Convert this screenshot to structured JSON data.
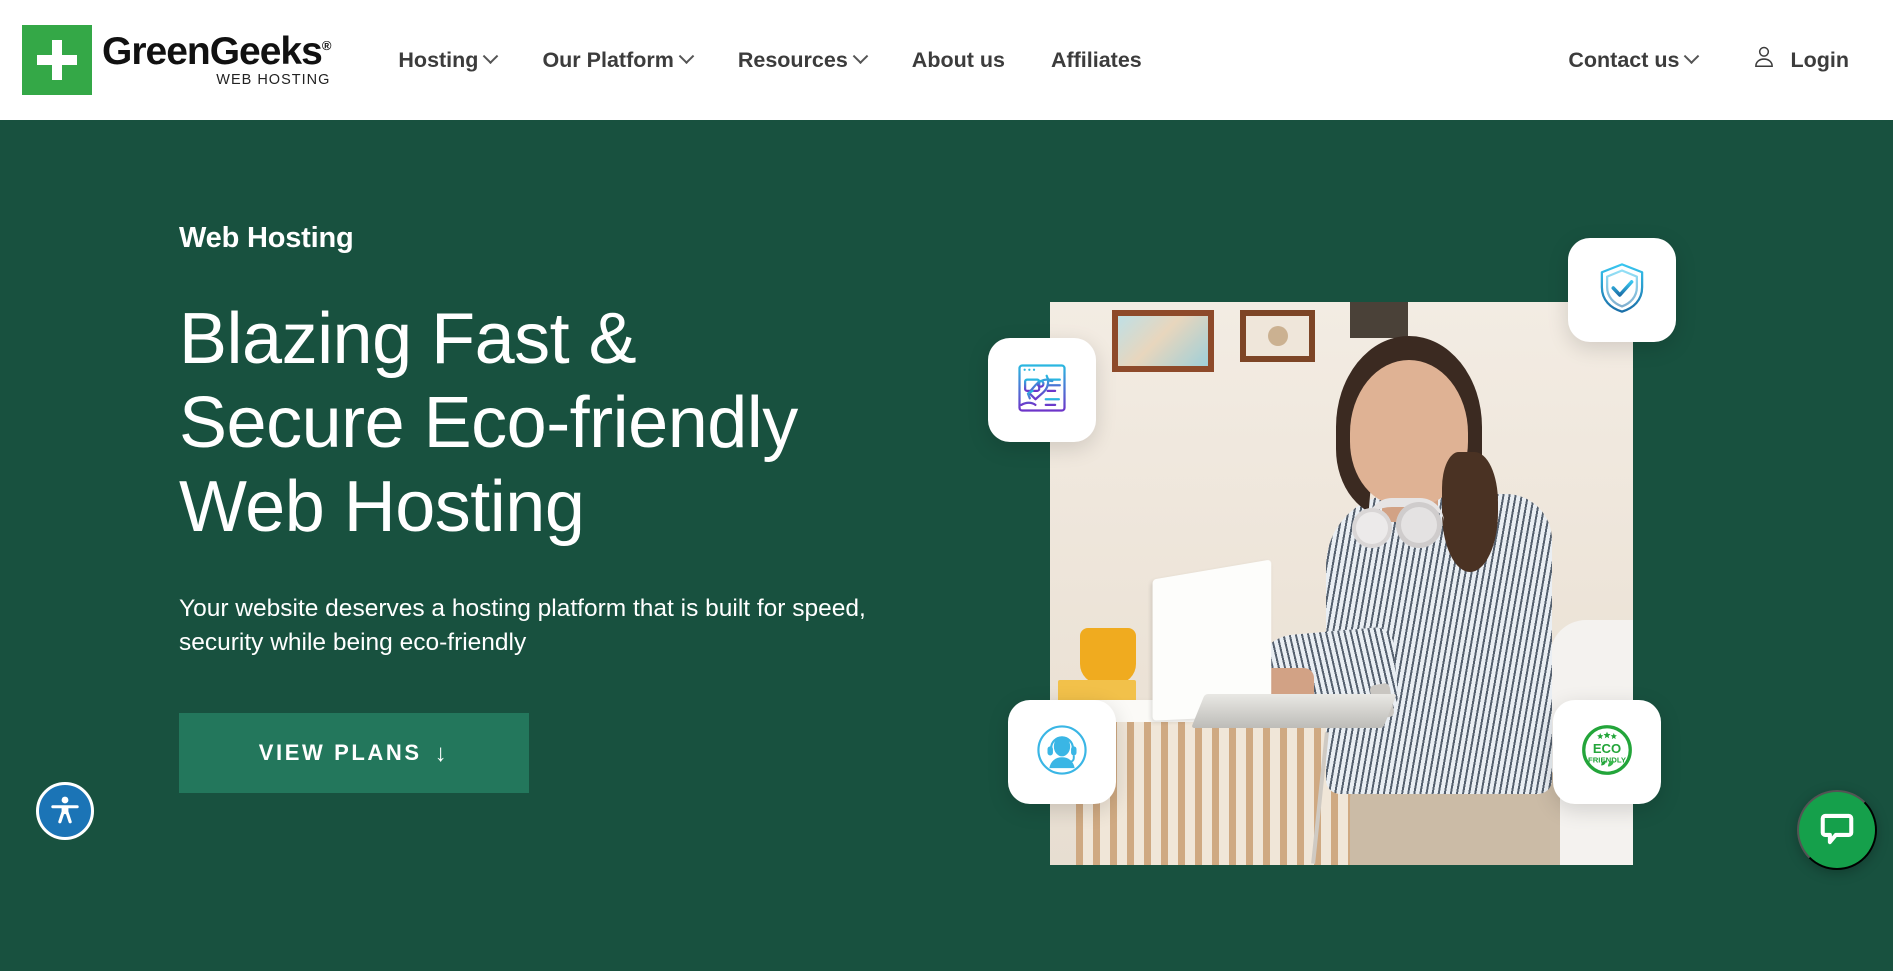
{
  "brand": {
    "name": "GreenGeeks",
    "registered": "®",
    "tagline": "WEB HOSTING",
    "logo_color": "#34a847"
  },
  "nav": {
    "items": [
      {
        "label": "Hosting",
        "has_dropdown": true
      },
      {
        "label": "Our Platform",
        "has_dropdown": true
      },
      {
        "label": "Resources",
        "has_dropdown": true
      },
      {
        "label": "About us",
        "has_dropdown": false
      },
      {
        "label": "Affiliates",
        "has_dropdown": false
      }
    ],
    "contact": {
      "label": "Contact us",
      "has_dropdown": true
    },
    "login": {
      "label": "Login",
      "icon": "user-icon"
    }
  },
  "hero": {
    "eyebrow": "Web Hosting",
    "title_line1": "Blazing Fast &",
    "title_line2": "Secure Eco-friendly",
    "title_line3": "Web Hosting",
    "subtitle": "Your website deserves a hosting platform that is built for speed, security while being eco-friendly",
    "cta_label": "VIEW PLANS",
    "cta_arrow": "↓",
    "background_color": "#18513f",
    "cta_color": "#23775c"
  },
  "feature_cards": [
    {
      "name": "rocket-launch-icon",
      "alt": "Rocket launching from browser window"
    },
    {
      "name": "shield-check-icon",
      "alt": "Shield with checkmark"
    },
    {
      "name": "support-agent-icon",
      "alt": "Support agent with headset"
    },
    {
      "name": "eco-friendly-badge-icon",
      "alt": "ECO FRIENDLY",
      "line1": "ECO",
      "line2": "FRIENDLY"
    }
  ],
  "widgets": {
    "accessibility": {
      "name": "accessibility-icon",
      "color": "#1b74b6"
    },
    "chat": {
      "name": "chat-bubble-icon",
      "color": "#15a04b"
    }
  }
}
